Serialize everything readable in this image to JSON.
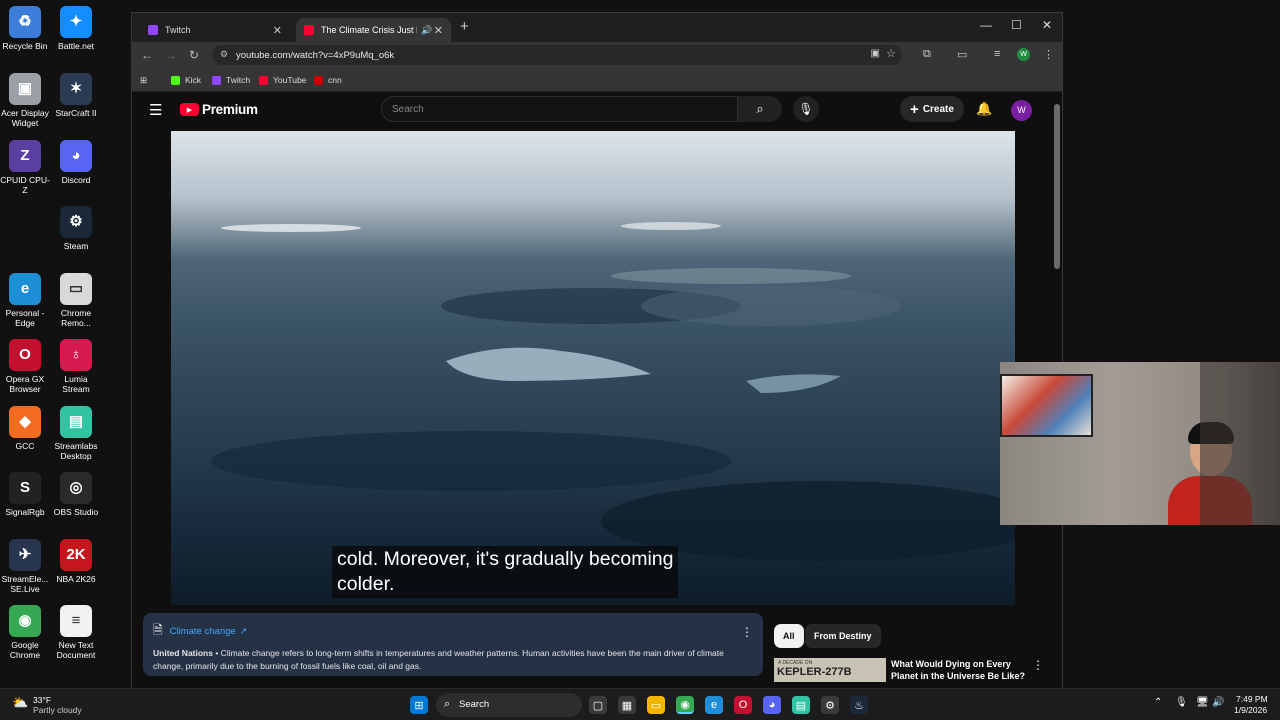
{
  "desktop_icons": [
    {
      "label": "Recycle Bin",
      "icon": "recycle-bin-icon",
      "color": "#3b7dd8",
      "glyph": "♻"
    },
    {
      "label": "Battle.net",
      "icon": "battlenet-icon",
      "color": "#148eff",
      "glyph": "✦"
    },
    {
      "label": "Acer Display Widget",
      "icon": "acer-display-widget-icon",
      "color": "#9aa0a6",
      "glyph": "▣"
    },
    {
      "label": "StarCraft II",
      "icon": "starcraft-icon",
      "color": "#2a3b52",
      "glyph": "✶"
    },
    {
      "label": "CPUID CPU-Z",
      "icon": "cpuz-icon",
      "color": "#5b3fa0",
      "glyph": "Z"
    },
    {
      "label": "Discord",
      "icon": "discord-icon",
      "color": "#5865f2",
      "glyph": "◕"
    },
    {
      "label": "Steam",
      "icon": "steam-icon",
      "color": "#1b2838",
      "glyph": "⚙"
    },
    {
      "label": "Personal - Edge",
      "icon": "edge-icon",
      "color": "#1e8fd6",
      "glyph": "e"
    },
    {
      "label": "Chrome Remo...",
      "icon": "chrome-remote-icon",
      "color": "#d9d9d9",
      "glyph": "▭"
    },
    {
      "label": "Opera GX Browser",
      "icon": "opera-gx-icon",
      "color": "#c3102f",
      "glyph": "O"
    },
    {
      "label": "Lumia Stream",
      "icon": "lumia-stream-icon",
      "color": "#d8194f",
      "glyph": "♁"
    },
    {
      "label": "GCC",
      "icon": "gcc-icon",
      "color": "#f26b21",
      "glyph": "◆"
    },
    {
      "label": "Streamlabs Desktop",
      "icon": "streamlabs-icon",
      "color": "#31c3a2",
      "glyph": "▤"
    },
    {
      "label": "SignalRgb",
      "icon": "signalrgb-icon",
      "color": "#222222",
      "glyph": "S"
    },
    {
      "label": "OBS Studio",
      "icon": "obs-icon",
      "color": "#2a2a2a",
      "glyph": "◎"
    },
    {
      "label": "StreamEle... SE.Live",
      "icon": "streamelements-icon",
      "color": "#27354f",
      "glyph": "✈"
    },
    {
      "label": "NBA 2K26",
      "icon": "nba2k-icon",
      "color": "#c4161c",
      "glyph": "2K"
    },
    {
      "label": "Google Chrome",
      "icon": "chrome-icon",
      "color": "#34a853",
      "glyph": "◉"
    },
    {
      "label": "New Text Document",
      "icon": "text-document-icon",
      "color": "#f2f2f2",
      "glyph": "≡"
    }
  ],
  "browser": {
    "tabs": [
      {
        "title": "Twitch",
        "favicon_color": "#9146ff"
      },
      {
        "title": "The Climate Crisis Just Hit a",
        "favicon_color": "#ff0033"
      }
    ],
    "url": "youtube.com/watch?v=4xP9uMq_o6k",
    "bookmarks": [
      {
        "label": "Kick",
        "color": "#53fc18"
      },
      {
        "label": "Twitch",
        "color": "#9146ff"
      },
      {
        "label": "YouTube",
        "color": "#ff0033"
      },
      {
        "label": "cnn",
        "color": "#cc0000"
      }
    ],
    "profile_initial": "W"
  },
  "youtube": {
    "logo_text": "Premium",
    "search_placeholder": "Search",
    "create_label": "Create",
    "avatar_initial": "W",
    "caption_line1": "cold. Moreover, it's gradually becoming",
    "caption_line2": "colder.",
    "info_panel": {
      "topic": "Climate change",
      "source": "United Nations",
      "text": " • Climate change refers to long-term shifts in temperatures and weather patterns. Human activities have been the main driver of climate change, primarily due to the burning of fossil fuels like coal, oil and gas."
    },
    "chips": [
      "All",
      "From Destiny"
    ],
    "recommendation": {
      "thumb_text": "KEPLER-277B",
      "thumb_sub": "A DECADE ON",
      "title": "What Would Dying on Every Planet in the Universe Be Like?"
    }
  },
  "taskbar": {
    "weather_temp": "33°F",
    "weather_desc": "Partly cloudy",
    "search_label": "Search",
    "time": "7:49 PM",
    "date": "1/9/2026"
  }
}
